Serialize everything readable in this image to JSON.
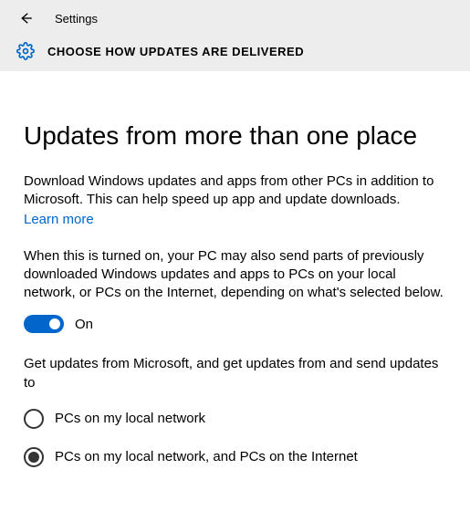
{
  "header": {
    "app_title": "Settings",
    "page_header": "CHOOSE HOW UPDATES ARE DELIVERED"
  },
  "main": {
    "heading": "Updates from more than one place",
    "paragraph1": "Download Windows updates and apps from other PCs in addition to Microsoft. This can help speed up app and update downloads.",
    "learn_more": "Learn more",
    "paragraph2": "When this is turned on, your PC may also send parts of previously downloaded Windows updates and apps to PCs on your local network, or PCs on the Internet, depending on what's selected below.",
    "toggle": {
      "state": "On",
      "value": true
    },
    "paragraph3": "Get updates from Microsoft, and get updates from and send updates to",
    "options": [
      {
        "label": "PCs on my local network",
        "selected": false
      },
      {
        "label": "PCs on my local network, and PCs on the Internet",
        "selected": true
      }
    ]
  },
  "colors": {
    "accent": "#0066cc"
  }
}
